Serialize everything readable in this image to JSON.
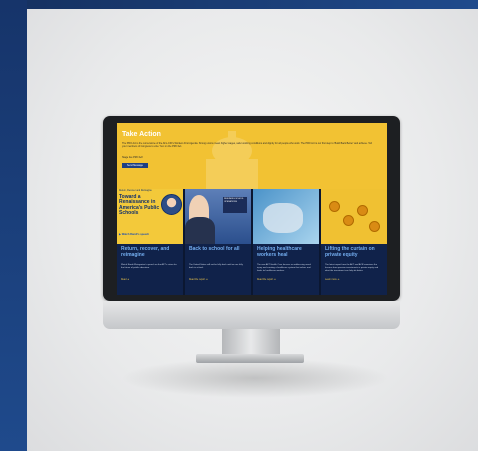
{
  "page": {
    "hero": {
      "title": "Take Action",
      "body": "The PRO Act is the cornerstone of the AFL-CIO's Workers First Agenda. Strong unions mean higher wages, safer working conditions and dignity for all people who work. The PRO Act is our first step to 'Build Back Better' and achieve. Tell your members of Congress to vote 'Yes' on the PRO Act.",
      "line": "Stage live PRO Act!",
      "button": "Send Message"
    },
    "cards": [
      {
        "kicker": "Return, Recover and Reimagine",
        "headline": "Toward a Renaissance in America's Public Schools",
        "cta": "Watch Randi's speech",
        "title": "Return, recover, and reimagine",
        "body": "Watch Randi Weingarten's speech on the AFT's vision for the future of public education.",
        "more": "Read",
        "icon": "play-icon"
      },
      {
        "sign": "RESUMING SCHOOL OPERATIONS",
        "title": "Back to school for all",
        "body": "The United States will not be fully back until we are fully back in school.",
        "more": "Read the report"
      },
      {
        "title": "Helping healthcare workers heal",
        "body": "The new AFT Health Care focuses on addressing moral injury and creating a healthcare system that values and heals its healthcare workers.",
        "more": "Read the report"
      },
      {
        "title": "Lifting the curtain on private equity",
        "body": "The latest report from the AFT and ACR examines the lessons from pension investments in private equity and what the investment can help do better.",
        "more": "Learn more"
      }
    ]
  },
  "colors": {
    "hero": "#f2c233",
    "dark": "#10224a",
    "title": "#74aef0",
    "accent": "#e8c24a",
    "frame": "#1f4a8c"
  }
}
